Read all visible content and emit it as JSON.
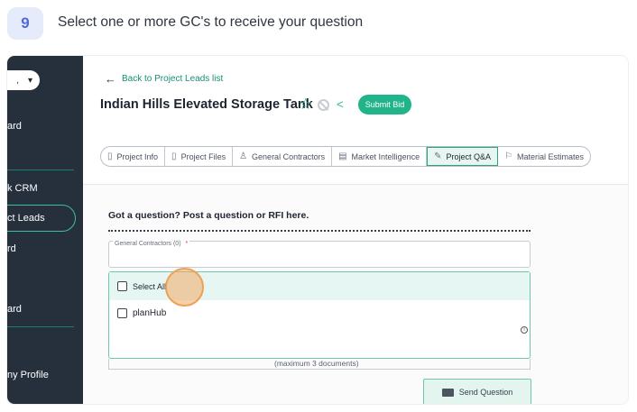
{
  "step": {
    "number": "9",
    "instruction": "Select one or more GC's to receive your question"
  },
  "sidebar": {
    "items": [
      {
        "label": "ard"
      },
      {
        "label": "k CRM"
      },
      {
        "label": "ct Leads"
      },
      {
        "label": "rd"
      },
      {
        "label": "ard"
      },
      {
        "label": "ny Profile"
      }
    ],
    "active_index": 2
  },
  "back_link": "Back to Project Leads list",
  "project_title": "Indian Hills Elevated Storage Tank",
  "submit_bid_label": "Submit Bid",
  "tabs": [
    {
      "label": "Project Info",
      "icon": "info-doc-icon"
    },
    {
      "label": "Project Files",
      "icon": "file-icon"
    },
    {
      "label": "General Contractors",
      "icon": "person-icon"
    },
    {
      "label": "Market Intelligence",
      "icon": "chart-doc-icon"
    },
    {
      "label": "Project Q&A",
      "icon": "qa-icon",
      "active": true
    },
    {
      "label": "Material Estimates",
      "icon": "estimate-icon"
    }
  ],
  "question_heading": "Got a question? Post a question or RFI here.",
  "gc_field": {
    "label": "General Contractors (0)",
    "required_mark": "*"
  },
  "dropdown_options": [
    {
      "label": "Select All"
    },
    {
      "label": "planHub"
    }
  ],
  "max_documents_text": "(maximum 3 documents)",
  "send_button_label": "Send Question",
  "colors": {
    "accent": "#21b48a",
    "sidebar_bg": "#26303d",
    "step_badge_bg": "#e6ebfb"
  }
}
